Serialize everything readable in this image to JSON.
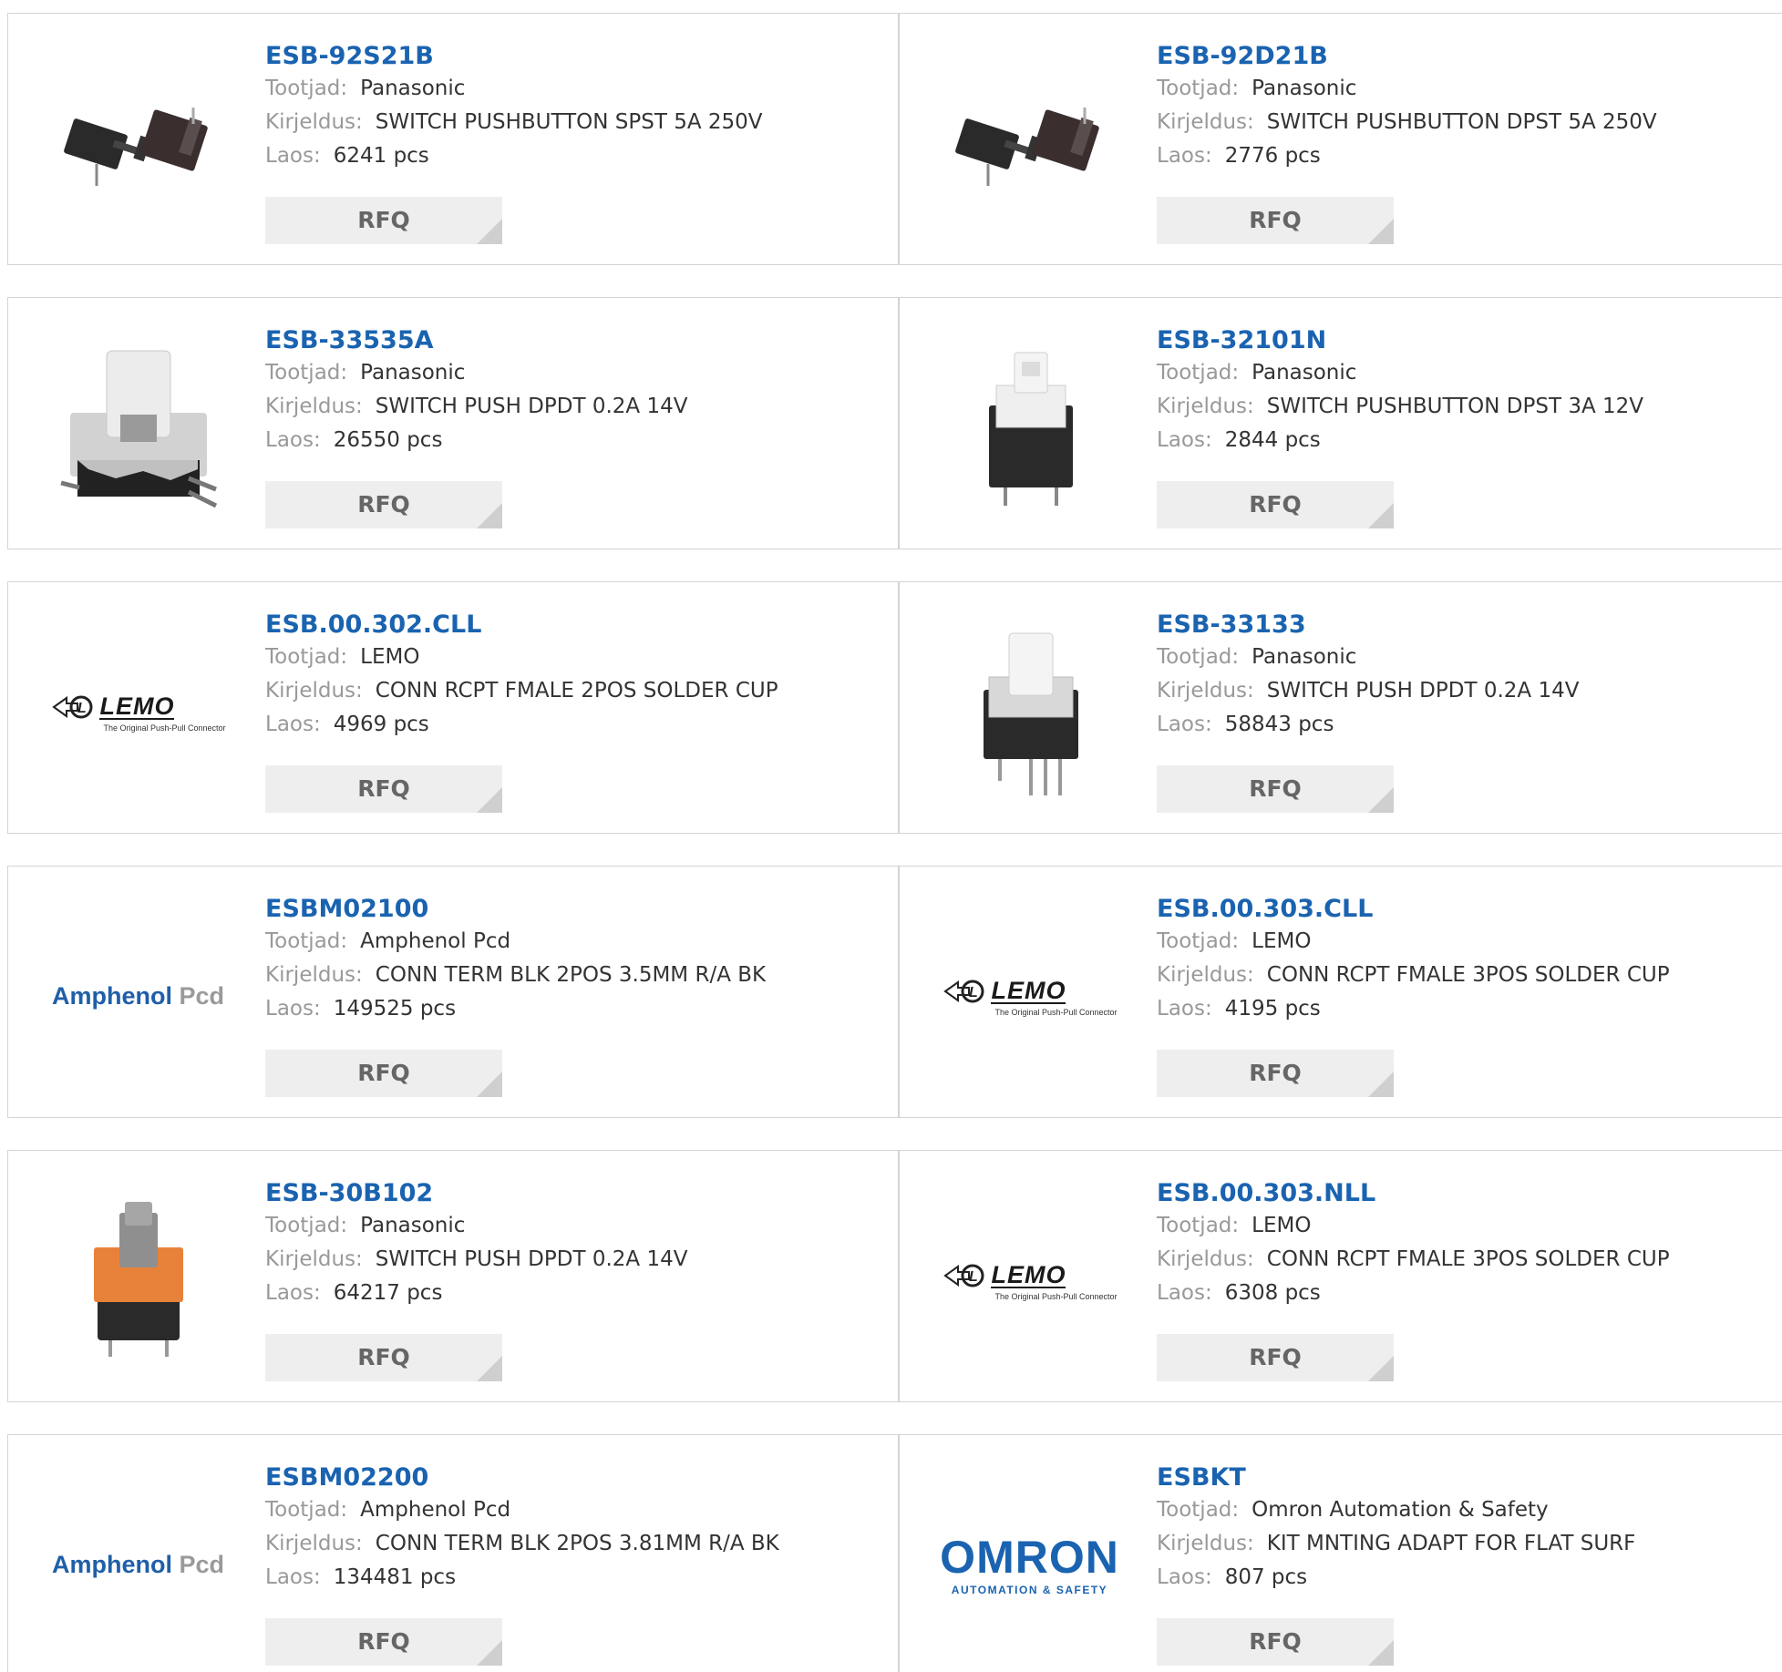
{
  "labels": {
    "manufacturer": "Tootjad:",
    "description": "Kirjeldus:",
    "stock": "Laos:",
    "rfq": "RFQ"
  },
  "products": [
    {
      "part": "ESB-92S21B",
      "manufacturer": "Panasonic",
      "description": "SWITCH PUSHBUTTON SPST 5A 250V",
      "stock": "6241 pcs",
      "image": "switch-pushbutton-pair-image"
    },
    {
      "part": "ESB-92D21B",
      "manufacturer": "Panasonic",
      "description": "SWITCH PUSHBUTTON DPST 5A 250V",
      "stock": "2776 pcs",
      "image": "switch-pushbutton-pair-image"
    },
    {
      "part": "ESB-33535A",
      "manufacturer": "Panasonic",
      "description": "SWITCH PUSH DPDT 0.2A 14V",
      "stock": "26550 pcs",
      "image": "switch-push-smd-image"
    },
    {
      "part": "ESB-32101N",
      "manufacturer": "Panasonic",
      "description": "SWITCH PUSHBUTTON DPST 3A 12V",
      "stock": "2844 pcs",
      "image": "switch-push-small-image"
    },
    {
      "part": "ESB.00.302.CLL",
      "manufacturer": "LEMO",
      "description": "CONN RCPT FMALE 2POS SOLDER CUP",
      "stock": "4969 pcs",
      "image": "lemo-logo"
    },
    {
      "part": "ESB-33133",
      "manufacturer": "Panasonic",
      "description": "SWITCH PUSH DPDT 0.2A 14V",
      "stock": "58843 pcs",
      "image": "switch-push-through-hole-image"
    },
    {
      "part": "ESBM02100",
      "manufacturer": "Amphenol Pcd",
      "description": "CONN TERM BLK 2POS 3.5MM R/A BK",
      "stock": "149525 pcs",
      "image": "amphenol-logo"
    },
    {
      "part": "ESB.00.303.CLL",
      "manufacturer": "LEMO",
      "description": "CONN RCPT FMALE 3POS SOLDER CUP",
      "stock": "4195 pcs",
      "image": "lemo-logo"
    },
    {
      "part": "ESB-30B102",
      "manufacturer": "Panasonic",
      "description": "SWITCH PUSH DPDT 0.2A 14V",
      "stock": "64217 pcs",
      "image": "switch-push-orange-image"
    },
    {
      "part": "ESB.00.303.NLL",
      "manufacturer": "LEMO",
      "description": "CONN RCPT FMALE 3POS SOLDER CUP",
      "stock": "6308 pcs",
      "image": "lemo-logo"
    },
    {
      "part": "ESBM02200",
      "manufacturer": "Amphenol Pcd",
      "description": "CONN TERM BLK 2POS 3.81MM R/A BK",
      "stock": "134481 pcs",
      "image": "amphenol-logo"
    },
    {
      "part": "ESBKT",
      "manufacturer": "Omron Automation & Safety",
      "description": "KIT MNTING ADAPT FOR FLAT SURF",
      "stock": "807 pcs",
      "image": "omron-logo"
    }
  ],
  "logos": {
    "amphenol_main": "Amphenol",
    "amphenol_sub": "Pcd",
    "lemo_word": "LEMO",
    "lemo_tag": "The Original Push-Pull Connector",
    "omron_word": "OMRON",
    "omron_sub": "AUTOMATION & SAFETY"
  },
  "colors": {
    "link": "#1a63b0",
    "label": "#999999",
    "value": "#333333",
    "rfq_bg": "#eeeeee",
    "border": "#d4d4d4"
  }
}
